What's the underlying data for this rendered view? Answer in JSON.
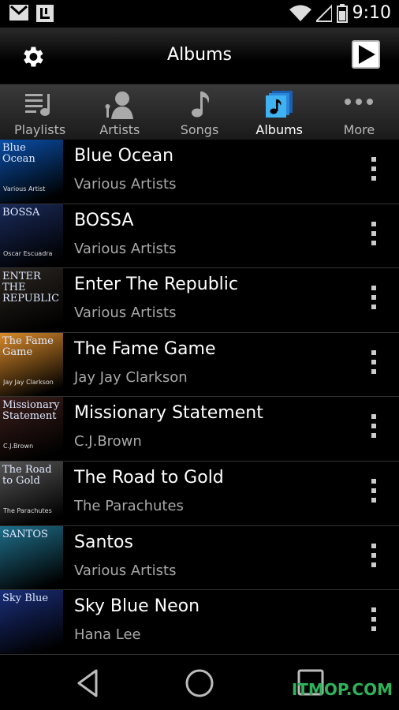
{
  "status_bar": {
    "time": "9:10",
    "icons": [
      "gmail-icon",
      "app-icon",
      "wifi-icon",
      "signal-icon",
      "battery-icon"
    ]
  },
  "action_bar": {
    "title": "Albums",
    "left_icon": "settings-gear-icon",
    "right_icon": "now-playing-icon"
  },
  "tabs": [
    {
      "label": "Playlists",
      "icon": "playlist-icon",
      "active": false
    },
    {
      "label": "Artists",
      "icon": "artist-icon",
      "active": false
    },
    {
      "label": "Songs",
      "icon": "song-icon",
      "active": false
    },
    {
      "label": "Albums",
      "icon": "album-icon",
      "active": true
    },
    {
      "label": "More",
      "icon": "more-dots-icon",
      "active": false
    }
  ],
  "albums": [
    {
      "title": "Blue Ocean",
      "artist": "Various Artists",
      "art_color": "#0a4fa8",
      "art_text": "Blue Ocean",
      "art_subtext": "Various Artist"
    },
    {
      "title": "BOSSA",
      "artist": "Various Artists",
      "art_color": "#1a2a5a",
      "art_text": "BOSSA",
      "art_subtext": "Oscar Escuadra"
    },
    {
      "title": "Enter The Republic",
      "artist": "Various Artists",
      "art_color": "#2b2620",
      "art_text": "ENTER THE REPUBLIC",
      "art_subtext": ""
    },
    {
      "title": "The Fame Game",
      "artist": "Jay Jay Clarkson",
      "art_color": "#d98a2a",
      "art_text": "The Fame Game",
      "art_subtext": "Jay Jay Clarkson"
    },
    {
      "title": "Missionary Statement",
      "artist": "C.J.Brown",
      "art_color": "#3a1e1a",
      "art_text": "Missionary Statement",
      "art_subtext": "C.J.Brown"
    },
    {
      "title": "The Road to Gold",
      "artist": "The Parachutes",
      "art_color": "#555555",
      "art_text": "The Road to Gold",
      "art_subtext": "The Parachutes"
    },
    {
      "title": "Santos",
      "artist": "Various Artists",
      "art_color": "#1f6f8a",
      "art_text": "SANTOS",
      "art_subtext": ""
    },
    {
      "title": "Sky Blue Neon",
      "artist": "Hana Lee",
      "art_color": "#1a2e7a",
      "art_text": "Sky Blue",
      "art_subtext": ""
    }
  ],
  "nav": {
    "watermark": "ITMOP.COM"
  }
}
